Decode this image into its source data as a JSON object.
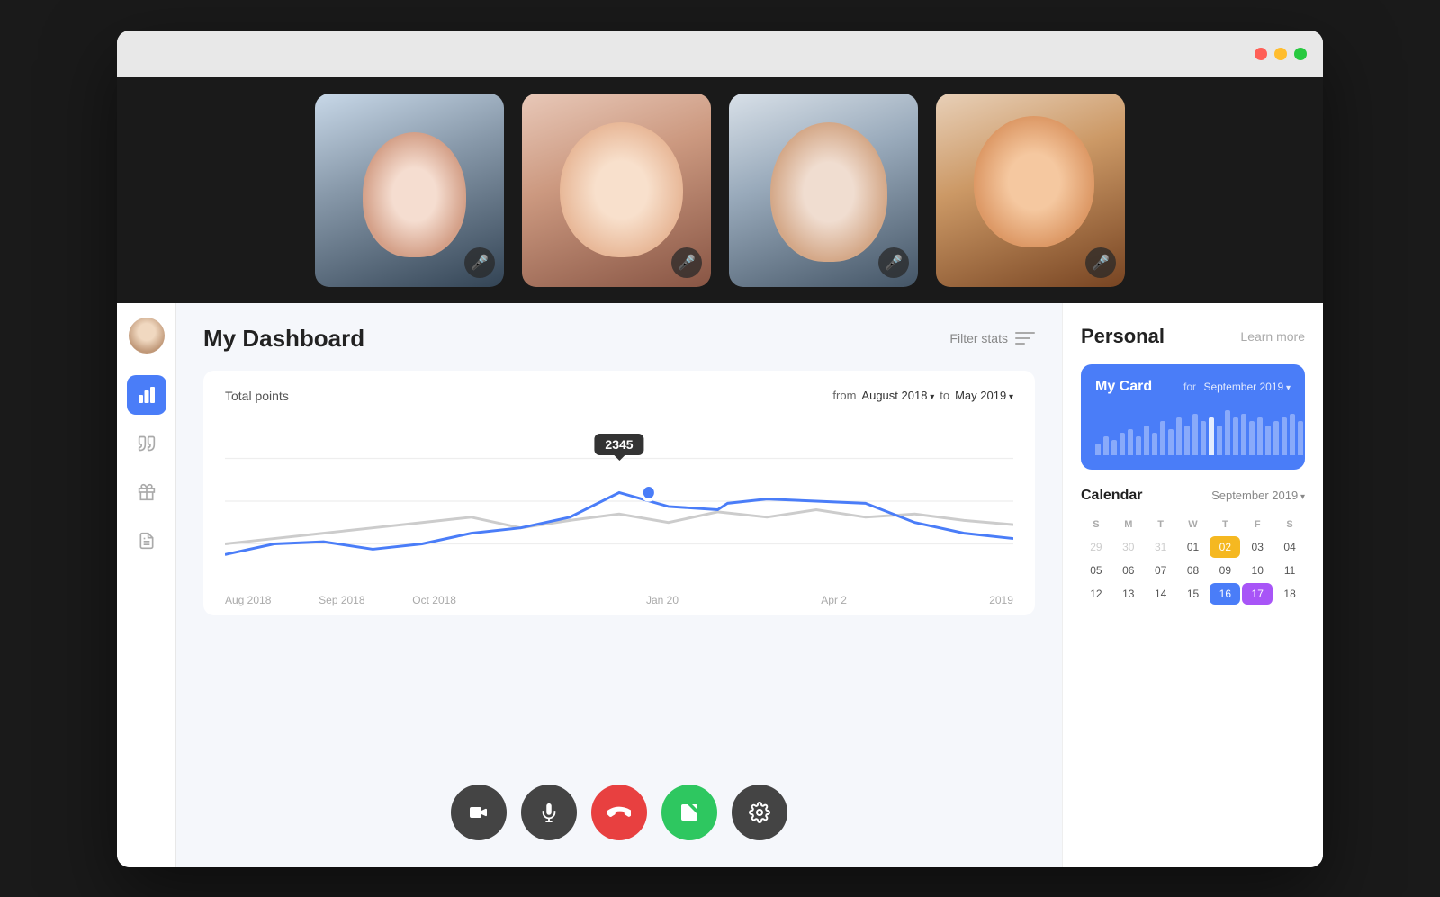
{
  "window": {
    "traffic_lights": [
      "red",
      "yellow",
      "green"
    ]
  },
  "video_tiles": [
    {
      "id": 1,
      "person_class": "person1",
      "mic_icon": "🎤"
    },
    {
      "id": 2,
      "person_class": "person2",
      "mic_icon": "🎤"
    },
    {
      "id": 3,
      "person_class": "person3",
      "mic_icon": "🎤"
    },
    {
      "id": 4,
      "person_class": "person4",
      "mic_icon": "🎤"
    }
  ],
  "sidebar": {
    "icons": [
      {
        "name": "chart-bar-icon",
        "label": "📊",
        "active": true
      },
      {
        "name": "brush-icon",
        "label": "🖌"
      },
      {
        "name": "gift-icon",
        "label": "🎁"
      },
      {
        "name": "document-icon",
        "label": "📄"
      }
    ]
  },
  "dashboard": {
    "title": "My Dashboard",
    "filter_label": "Filter stats",
    "chart": {
      "title": "Total points",
      "from_label": "from",
      "from_value": "August 2018",
      "to_label": "to",
      "to_value": "May 2019",
      "tooltip_value": "2345",
      "labels": [
        "Aug 2018",
        "Sep 2018",
        "Oct 2018",
        "",
        "",
        "",
        "Jan 20",
        "",
        "",
        "Apr 2",
        "",
        "",
        "",
        "2019"
      ]
    }
  },
  "call_controls": [
    {
      "name": "video-btn",
      "icon": "📹",
      "style": "ctrl-dark"
    },
    {
      "name": "mic-btn",
      "icon": "🎤",
      "style": "ctrl-dark"
    },
    {
      "name": "hangup-btn",
      "icon": "📞",
      "style": "ctrl-red"
    },
    {
      "name": "share-btn",
      "icon": "↗",
      "style": "ctrl-green"
    },
    {
      "name": "settings-btn",
      "icon": "⚙",
      "style": "ctrl-dark"
    }
  ],
  "right_panel": {
    "title": "Personal",
    "learn_more": "Learn more",
    "my_card": {
      "label": "My Card",
      "for_label": "for",
      "period": "September 2019",
      "bars": [
        3,
        5,
        4,
        6,
        7,
        5,
        8,
        6,
        9,
        7,
        10,
        8,
        11,
        9,
        10,
        8,
        12,
        10,
        11,
        9,
        10,
        8,
        9,
        10,
        11,
        9,
        8,
        7
      ]
    },
    "calendar": {
      "title": "Calendar",
      "month": "September 2019",
      "headers": [
        "S",
        "M",
        "T",
        "W",
        "T",
        "F",
        "S"
      ],
      "weeks": [
        [
          "29",
          "30",
          "31",
          "01",
          "02",
          "03",
          "04"
        ],
        [
          "05",
          "06",
          "07",
          "08",
          "09",
          "10",
          "11"
        ],
        [
          "12",
          "13",
          "14",
          "15",
          "16",
          "17",
          "18"
        ]
      ],
      "today": "16",
      "highlight": "17",
      "event": "02",
      "prev_month_days": [
        "29",
        "30",
        "31"
      ]
    }
  }
}
